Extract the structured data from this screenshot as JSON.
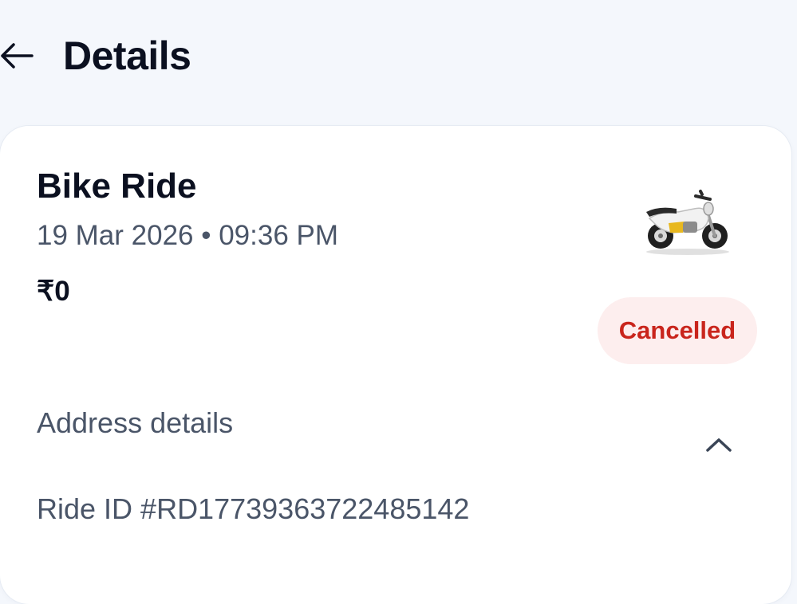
{
  "header": {
    "back_icon": "arrow-left-icon",
    "title": "Details"
  },
  "ride": {
    "title": "Bike Ride",
    "datetime": "19 Mar 2026 • 09:36 PM",
    "fare": "₹0",
    "vehicle_icon": "motorbike-icon",
    "status": "Cancelled",
    "status_colors": {
      "text": "#c9251c",
      "background": "#fdeeee"
    }
  },
  "address": {
    "label": "Address details",
    "toggle_icon": "chevron-up-icon"
  },
  "ride_id": "Ride ID #RD17739363722485142",
  "colors": {
    "page_background": "#f4f7fc",
    "card_background": "#ffffff",
    "primary_text": "#0b1020",
    "secondary_text": "#4a5568"
  }
}
